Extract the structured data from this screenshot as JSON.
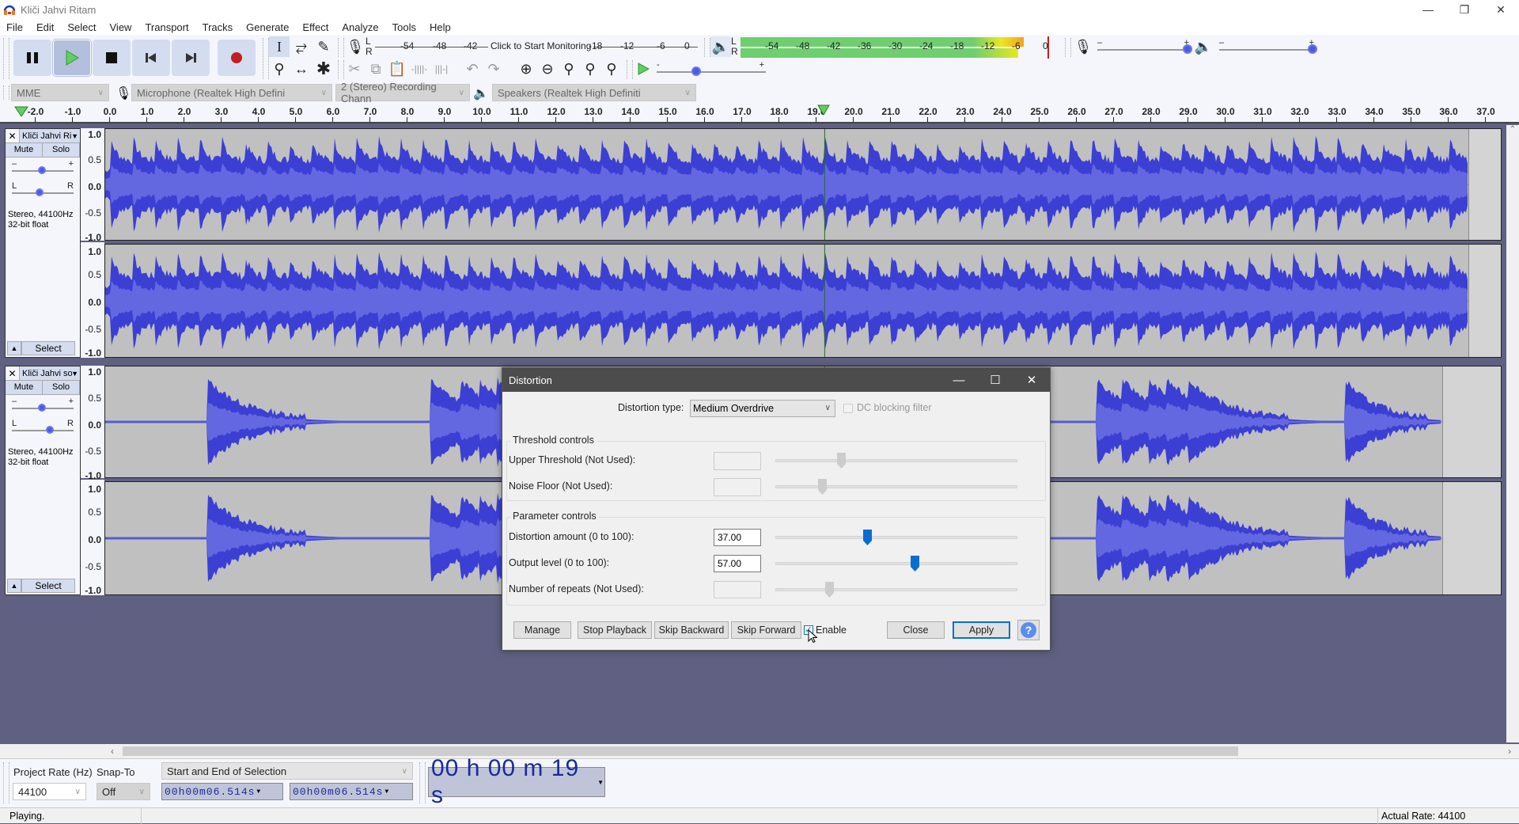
{
  "window": {
    "title": "Kliči Jahvi Ritam"
  },
  "menu": [
    "File",
    "Edit",
    "Select",
    "View",
    "Transport",
    "Tracks",
    "Generate",
    "Effect",
    "Analyze",
    "Tools",
    "Help"
  ],
  "transport": {
    "buttons": [
      {
        "name": "pause-button",
        "icon": "pause-icon"
      },
      {
        "name": "play-button",
        "icon": "play-icon",
        "active": true
      },
      {
        "name": "stop-button",
        "icon": "stop-icon"
      },
      {
        "name": "skip-start-button",
        "icon": "skip-start-icon"
      },
      {
        "name": "skip-end-button",
        "icon": "skip-end-icon"
      },
      {
        "name": "record-button",
        "icon": "record-icon"
      }
    ]
  },
  "recording_meter": {
    "ticks": [
      "-54",
      "-48",
      "-42",
      "-18",
      "-12",
      "-6",
      "0"
    ],
    "prompt": "Click to Start Monitoring",
    "channels": [
      "L",
      "R"
    ]
  },
  "playback_meter": {
    "ticks": [
      "-54",
      "-48",
      "-42",
      "-36",
      "-30",
      "-24",
      "-18",
      "-12",
      "-6",
      "0"
    ],
    "channels": [
      "L",
      "R"
    ],
    "level_db_L": -5,
    "level_db_R": -6
  },
  "play_at_speed": {
    "min": "-",
    "max": "+",
    "value": 0.35
  },
  "mixer": {
    "record_volume": 1.0,
    "playback_volume": 1.0
  },
  "devices": {
    "host": "MME",
    "recording_device": "Microphone (Realtek High Defini",
    "channels": "2 (Stereo) Recording Chann",
    "playback_device": "Speakers (Realtek High Definiti"
  },
  "timeline": {
    "ticks": [
      "-2.0",
      "-1.0",
      "0.0",
      "1.0",
      "2.0",
      "3.0",
      "4.0",
      "5.0",
      "6.0",
      "7.0",
      "8.0",
      "9.0",
      "10.0",
      "11.0",
      "12.0",
      "13.0",
      "14.0",
      "15.0",
      "16.0",
      "17.0",
      "18.0",
      "19.0",
      "20.0",
      "21.0",
      "22.0",
      "23.0",
      "24.0",
      "25.0",
      "26.0",
      "27.0",
      "28.0",
      "29.0",
      "30.0",
      "31.0",
      "32.0",
      "33.0",
      "34.0",
      "35.0",
      "36.0",
      "37.0"
    ],
    "play_position_s": 19.2
  },
  "tracks": [
    {
      "name": "Kliči Jahvi Ri",
      "mute": "Mute",
      "solo": "Solo",
      "info1": "Stereo, 44100Hz",
      "info2": "32-bit float",
      "select": "Select",
      "gain": 0.5,
      "pan": 0.45,
      "end_s": 36.5,
      "kind": "dense"
    },
    {
      "name": "Kliči Jahvi so",
      "mute": "Mute",
      "solo": "Solo",
      "info1": "Stereo, 44100Hz",
      "info2": "32-bit float",
      "select": "Select",
      "gain": 0.5,
      "pan": 0.5,
      "end_s": 35.8,
      "kind": "sparse"
    }
  ],
  "amp_scale": [
    "1.0",
    "0.5",
    "0.0",
    "-0.5",
    "-1.0"
  ],
  "dialog": {
    "title": "Distortion",
    "type_label": "Distortion type:",
    "type_value": "Medium Overdrive",
    "dc_filter_label": "DC blocking filter",
    "dc_filter_checked": false,
    "threshold_group": "Threshold controls",
    "upper_threshold_label": "Upper Threshold (Not Used):",
    "upper_threshold_value": "",
    "upper_threshold_slider": 0.26,
    "noise_floor_label": "Noise Floor (Not Used):",
    "noise_floor_value": "",
    "noise_floor_slider": 0.18,
    "parameter_group": "Parameter controls",
    "distortion_amount_label": "Distortion amount (0 to 100):",
    "distortion_amount_value": "37.00",
    "distortion_amount": 37,
    "output_level_label": "Output level (0 to 100):",
    "output_level_value": "57.00",
    "output_level": 57,
    "repeats_label": "Number of repeats (Not Used):",
    "repeats_value": "",
    "repeats_slider": 0.21,
    "buttons": {
      "manage": "Manage",
      "stop_playback": "Stop Playback",
      "skip_backward": "Skip Backward",
      "skip_forward": "Skip Forward",
      "enable": "Enable",
      "close": "Close",
      "apply": "Apply",
      "help": "?"
    },
    "enable_checked": true
  },
  "bottom": {
    "project_rate_label": "Project Rate (Hz)",
    "project_rate": "44100",
    "snap_label": "Snap-To",
    "snap": "Off",
    "selection_mode": "Start and End of Selection",
    "sel_start": "00h00m06.514s",
    "sel_end": "00h00m06.514s",
    "audio_position": "00 h 00 m 19 s"
  },
  "status": {
    "text": "Playing.",
    "actual_rate": "Actual Rate: 44100"
  }
}
